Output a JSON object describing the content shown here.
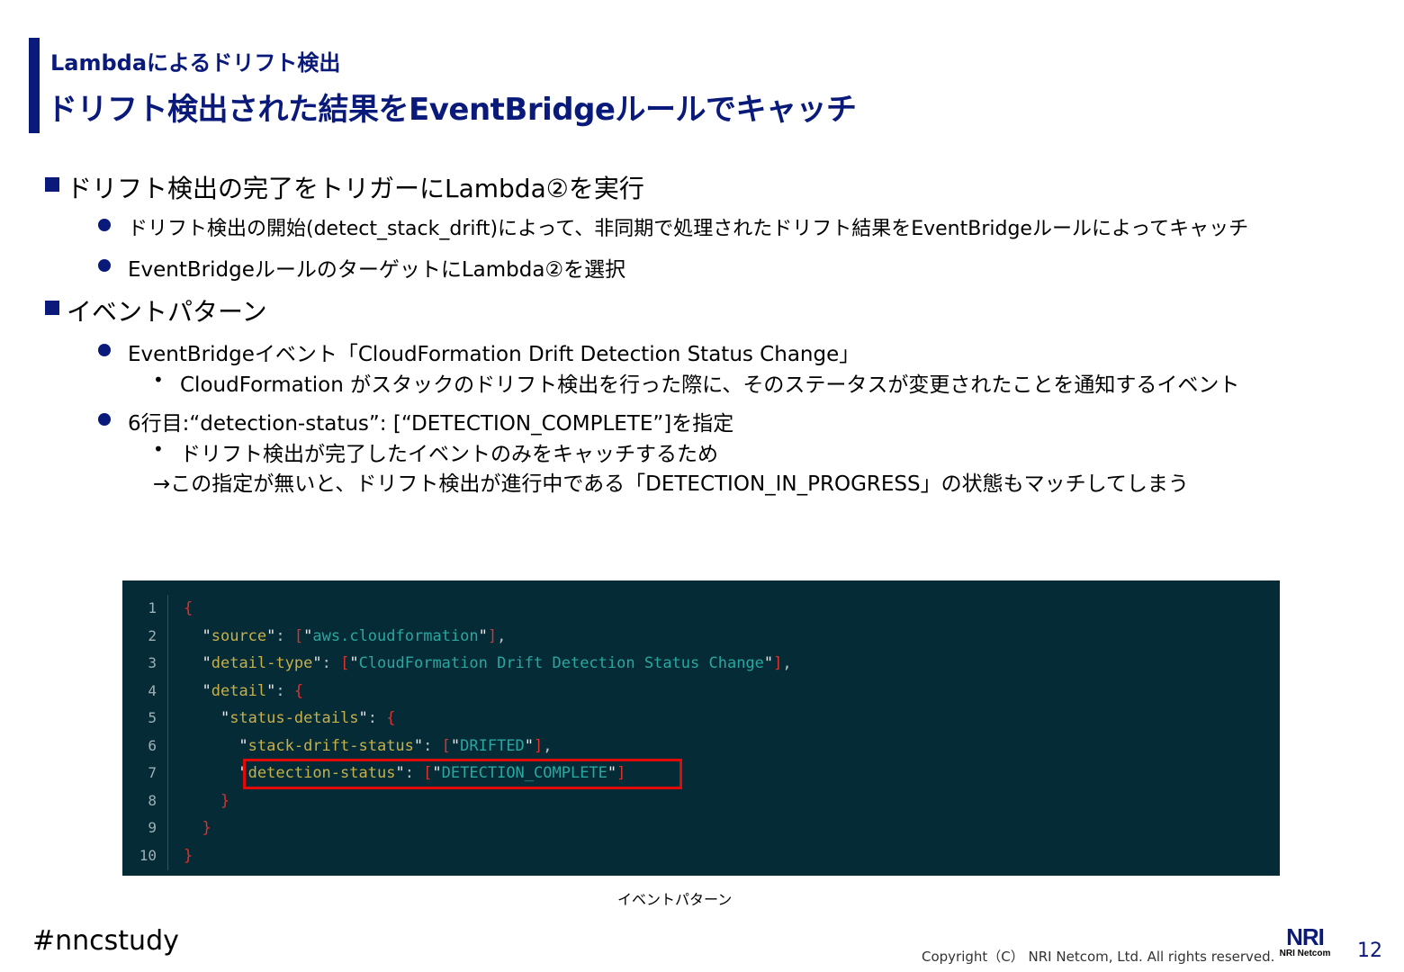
{
  "header": {
    "subtitle": "Lambdaによるドリフト検出",
    "title": "ドリフト検出された結果をEventBridgeルールでキャッチ"
  },
  "content": {
    "section1": {
      "heading": "ドリフト検出の完了をトリガーにLambda②を実行",
      "bullets": [
        "ドリフト検出の開始(detect_stack_drift)によって、非同期で処理されたドリフト結果をEventBridgeルールによってキャッチ",
        "EventBridgeルールのターゲットにLambda②を選択"
      ]
    },
    "section2": {
      "heading": "イベントパターン",
      "bullet1": "EventBridgeイベント「CloudFormation Drift Detection Status Change」",
      "bullet1_sub": "CloudFormation がスタックのドリフト検出を行った際に、そのステータスが変更されたことを通知するイベント",
      "bullet2": "6行目:“detection-status”: [“DETECTION_COMPLETE”]を指定",
      "bullet2_sub": "ドリフト検出が完了したイベントのみをキャッチするため",
      "bullet2_note": "→この指定が無いと、ドリフト検出が進行中である「DETECTION_IN_PROGRESS」の状態もマッチしてしまう"
    }
  },
  "code": {
    "line_numbers": [
      "1",
      "2",
      "3",
      "4",
      "5",
      "6",
      "7",
      "8",
      "9",
      "10"
    ],
    "tokens": {
      "source_key": "source",
      "source_val": "aws.cloudformation",
      "detail_type_key": "detail-type",
      "detail_type_val": "CloudFormation Drift Detection Status Change",
      "detail_key": "detail",
      "status_details_key": "status-details",
      "stack_drift_key": "stack-drift-status",
      "stack_drift_val": "DRIFTED",
      "detection_key": "detection-status",
      "detection_val": "DETECTION_COMPLETE"
    },
    "colors": {
      "background": "#042b36",
      "key": "#c7b04a",
      "string": "#2aa7a0",
      "punctuation": "#dc322f",
      "highlight": "#e10a0a"
    }
  },
  "caption": "イベントパターン",
  "footer": {
    "hashtag": "#nncstudy",
    "copyright": "Copyright（C） NRI Netcom, Ltd. All rights reserved.",
    "logo_mark": "NRI",
    "logo_sub": "NRI Netcom",
    "page_number": "12"
  },
  "colors": {
    "brand": "#0a1a7a"
  }
}
